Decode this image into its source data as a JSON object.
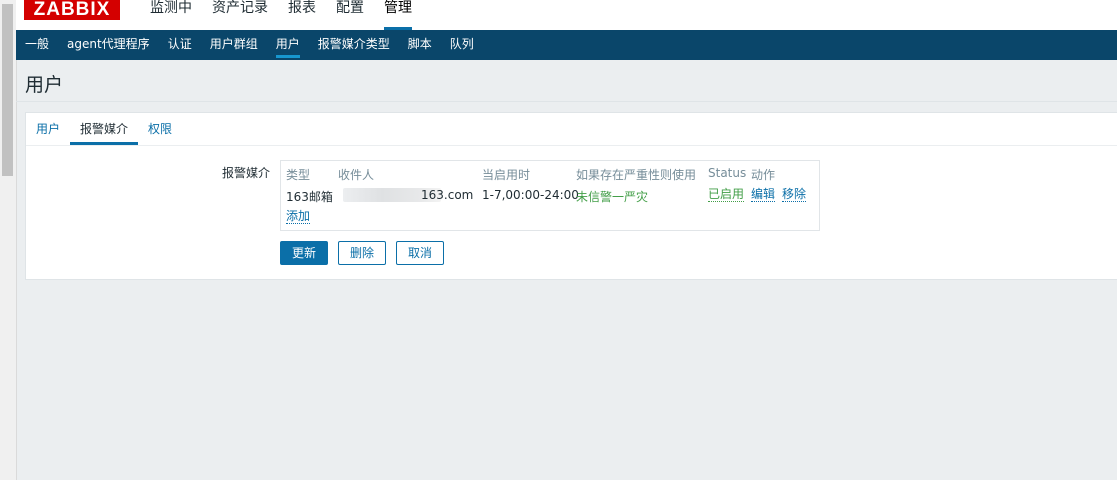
{
  "header": {
    "logo": "ZABBIX",
    "menu": [
      "监测中",
      "资产记录",
      "报表",
      "配置",
      "管理"
    ],
    "active_menu": "管理"
  },
  "subnav": {
    "items": [
      "一般",
      "agent代理程序",
      "认证",
      "用户群组",
      "用户",
      "报警媒介类型",
      "脚本",
      "队列"
    ],
    "active": "用户"
  },
  "page": {
    "title": "用户"
  },
  "tabs": {
    "items": [
      "用户",
      "报警媒介",
      "权限"
    ],
    "active": "报警媒介"
  },
  "form": {
    "label": "报警媒介",
    "table": {
      "headers": [
        "类型",
        "收件人",
        "当启用时",
        "如果存在严重性则使用",
        "Status",
        "动作"
      ],
      "rows": [
        {
          "type": "163邮箱",
          "recipient_visible": "163.com",
          "when_active": "1-7,00:00-24:00",
          "severity": "未信警一严灾",
          "status": "已启用",
          "actions": [
            "编辑",
            "移除"
          ]
        }
      ],
      "add_link": "添加"
    }
  },
  "buttons": {
    "update": "更新",
    "delete": "删除",
    "cancel": "取消"
  },
  "colors": {
    "nav": "#0a466a",
    "accent": "#0b6fa8",
    "logo": "#d40000",
    "status_green": "#429e47"
  }
}
